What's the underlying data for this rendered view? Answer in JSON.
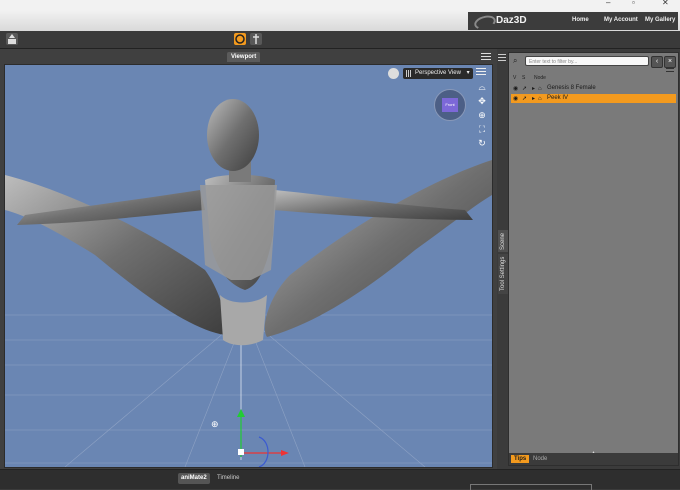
{
  "window": {
    "minimize": "–",
    "restore": "▫",
    "close": "✕"
  },
  "banner": {
    "brand": "Daz3D",
    "nav": [
      "Home",
      "My Account",
      "My Gallery"
    ]
  },
  "toolbar": {
    "icons": [
      "scene-import-icon",
      "pose-tool-icon",
      "node-tool-icon"
    ]
  },
  "viewport": {
    "tab_label": "Viewport",
    "view_label": "Perspective View",
    "cube_face": "Front"
  },
  "scene": {
    "filter_placeholder": "Enter text to filter by...",
    "col_v": "V",
    "col_s": "S",
    "col_node": "Node",
    "nodes": [
      {
        "label": "Genesis 8 Female",
        "selected": false
      },
      {
        "label": "Peek IV",
        "selected": true
      }
    ],
    "vtabs": [
      "Scene",
      "Tool Settings"
    ],
    "footer_tips": "Tips",
    "footer_node": "Node"
  },
  "bottom": {
    "tabs": [
      "aniMate2",
      "Timeline"
    ]
  },
  "colors": {
    "accent": "#f39a1e",
    "viewport_bg": "#6a86b3"
  }
}
